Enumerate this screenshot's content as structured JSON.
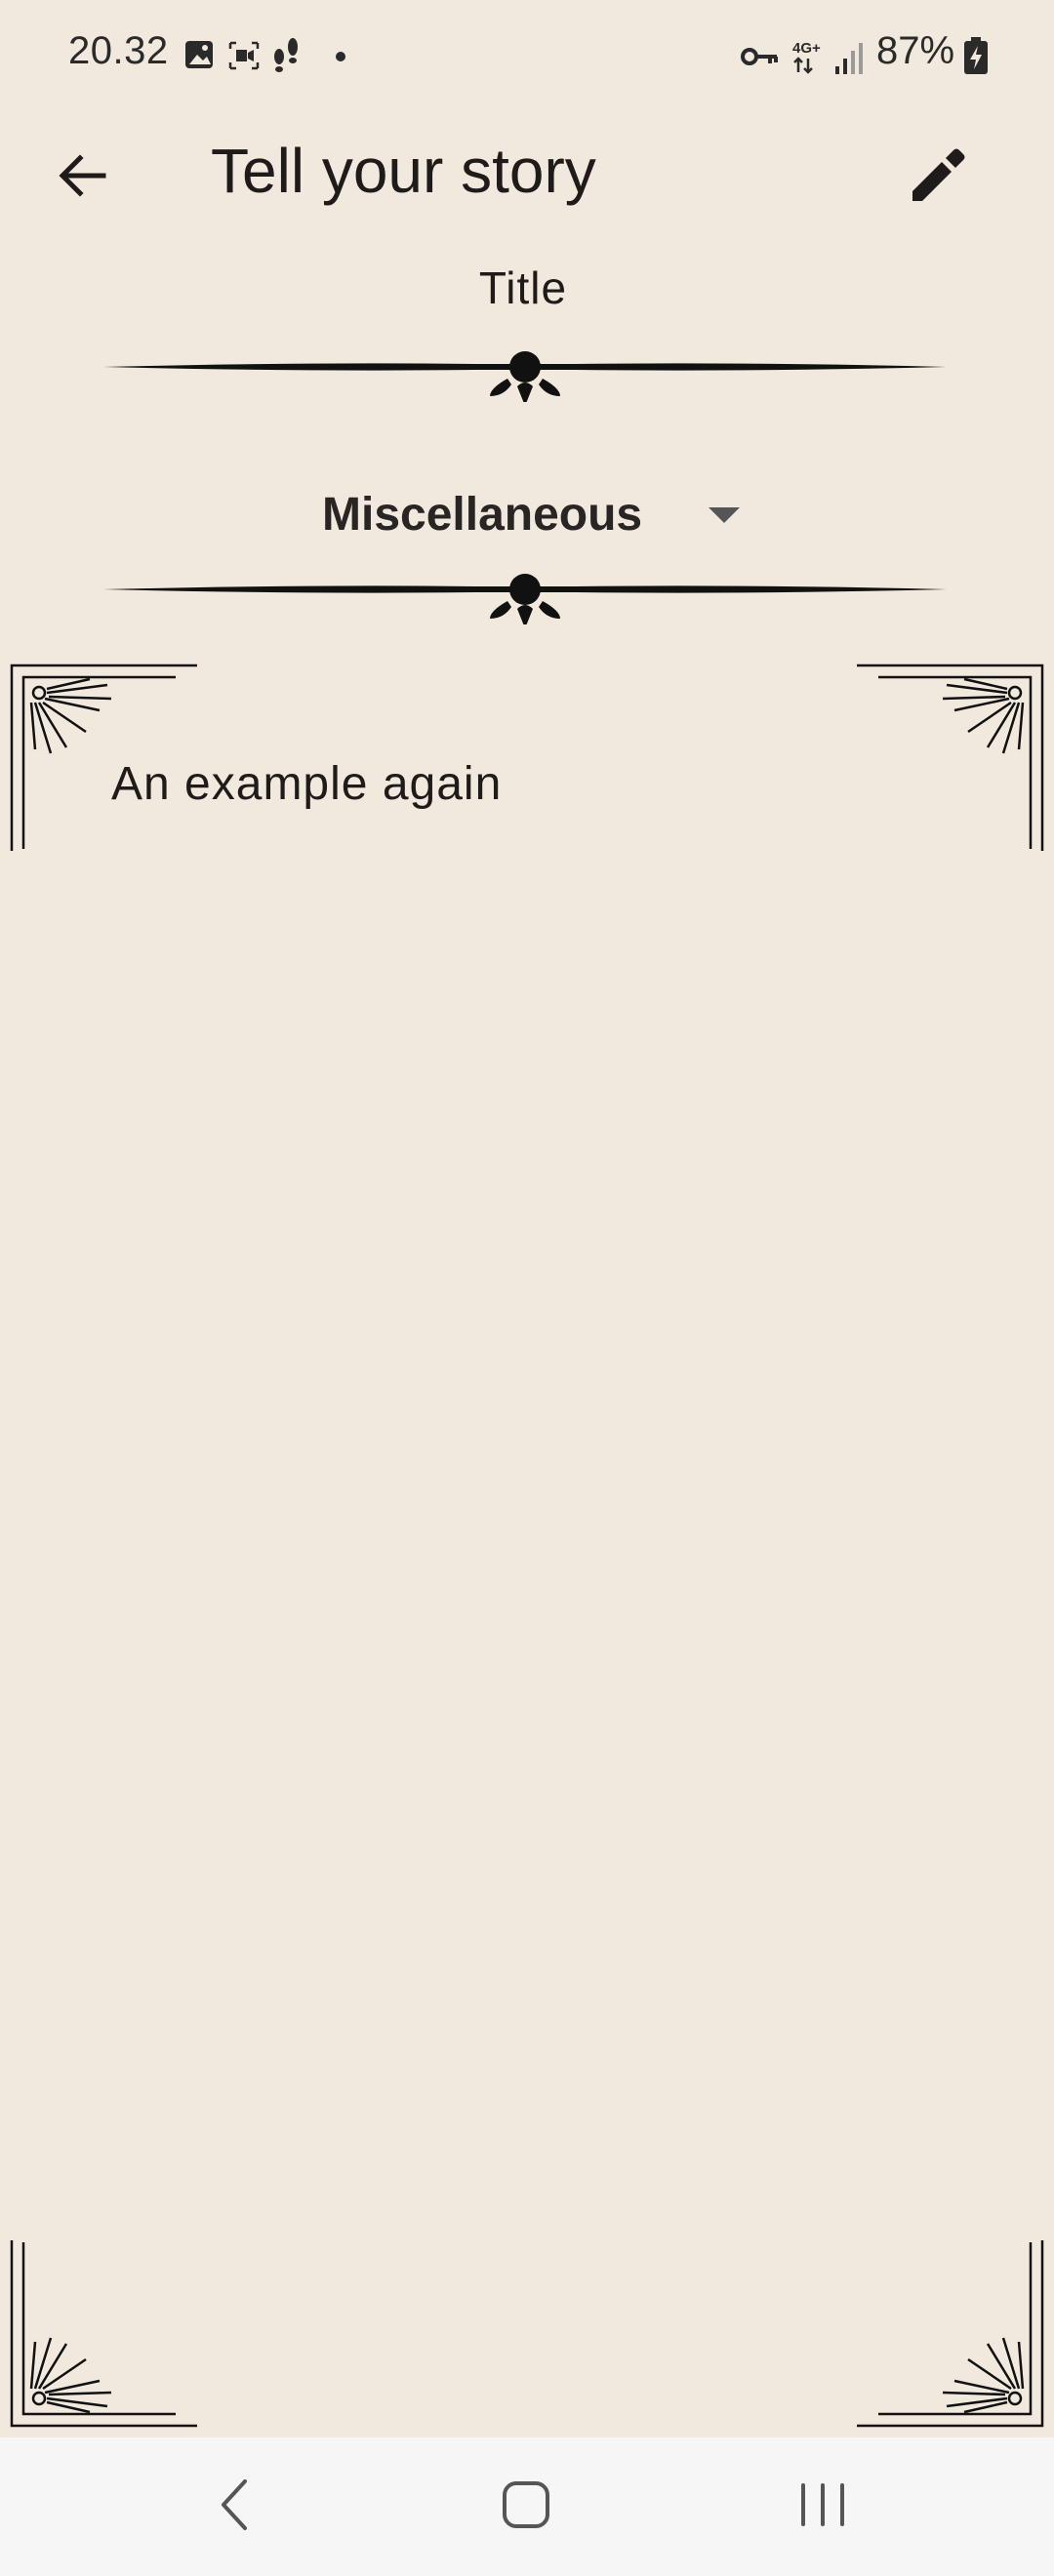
{
  "status_bar": {
    "time": "20.32",
    "battery": "87%",
    "left_icons": [
      "gallery-icon",
      "screen-record-icon",
      "steps-icon",
      "dot-icon"
    ],
    "right_icons": [
      "vpn-key-icon",
      "4g-plus-data-icon",
      "signal-icon",
      "battery-charging-icon"
    ],
    "network_label": "4G+"
  },
  "app_bar": {
    "title": "Tell your story",
    "back_icon": "arrow-back-icon",
    "edit_icon": "pencil-icon"
  },
  "story": {
    "title_placeholder": "Title",
    "category": "Miscellaneous",
    "body": "An example again"
  },
  "nav_bar": {
    "back_icon": "nav-back-icon",
    "home_icon": "nav-home-icon",
    "recents_icon": "nav-recents-icon"
  },
  "colors": {
    "background": "#f1e9dd",
    "text": "#1f1b1a",
    "nav_background": "#f6f6f7",
    "ornament": "#111111"
  }
}
